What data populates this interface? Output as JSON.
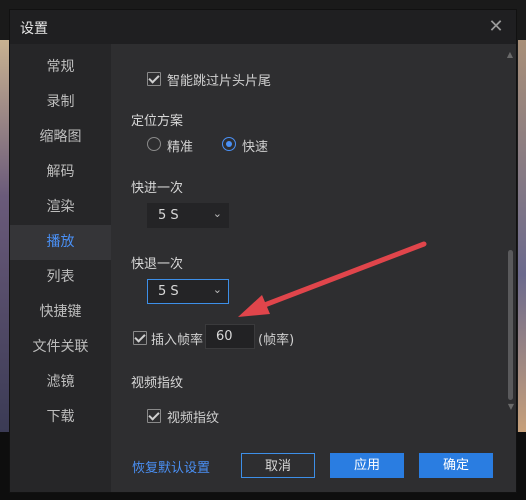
{
  "window": {
    "title": "设置",
    "close_label": "✕"
  },
  "sidebar": {
    "items": [
      {
        "label": "常规"
      },
      {
        "label": "录制"
      },
      {
        "label": "缩略图"
      },
      {
        "label": "解码"
      },
      {
        "label": "渲染"
      },
      {
        "label": "播放"
      },
      {
        "label": "列表"
      },
      {
        "label": "快捷键"
      },
      {
        "label": "文件关联"
      },
      {
        "label": "滤镜"
      },
      {
        "label": "下载"
      }
    ],
    "active_index": 5
  },
  "settings": {
    "skip_intro": {
      "label": "智能跳过片头片尾",
      "checked": true
    },
    "positioning": {
      "title": "定位方案",
      "options": [
        {
          "label": "精准",
          "selected": false
        },
        {
          "label": "快速",
          "selected": true
        }
      ]
    },
    "fast_forward": {
      "title": "快进一次",
      "value": "5 S"
    },
    "rewind": {
      "title": "快退一次",
      "value": "5 S"
    },
    "insert_frames": {
      "label": "插入帧率",
      "checked": true,
      "value": "60",
      "unit": "(帧率)"
    },
    "fingerprint": {
      "title": "视频指纹",
      "label": "视频指纹",
      "checked": true
    }
  },
  "footer": {
    "restore_label": "恢复默认设置",
    "cancel_label": "取消",
    "apply_label": "应用",
    "ok_label": "确定"
  },
  "colors": {
    "accent": "#2a7de1",
    "active_sidebar_text": "#4a90f5",
    "annotation_arrow": "#e0454b"
  }
}
